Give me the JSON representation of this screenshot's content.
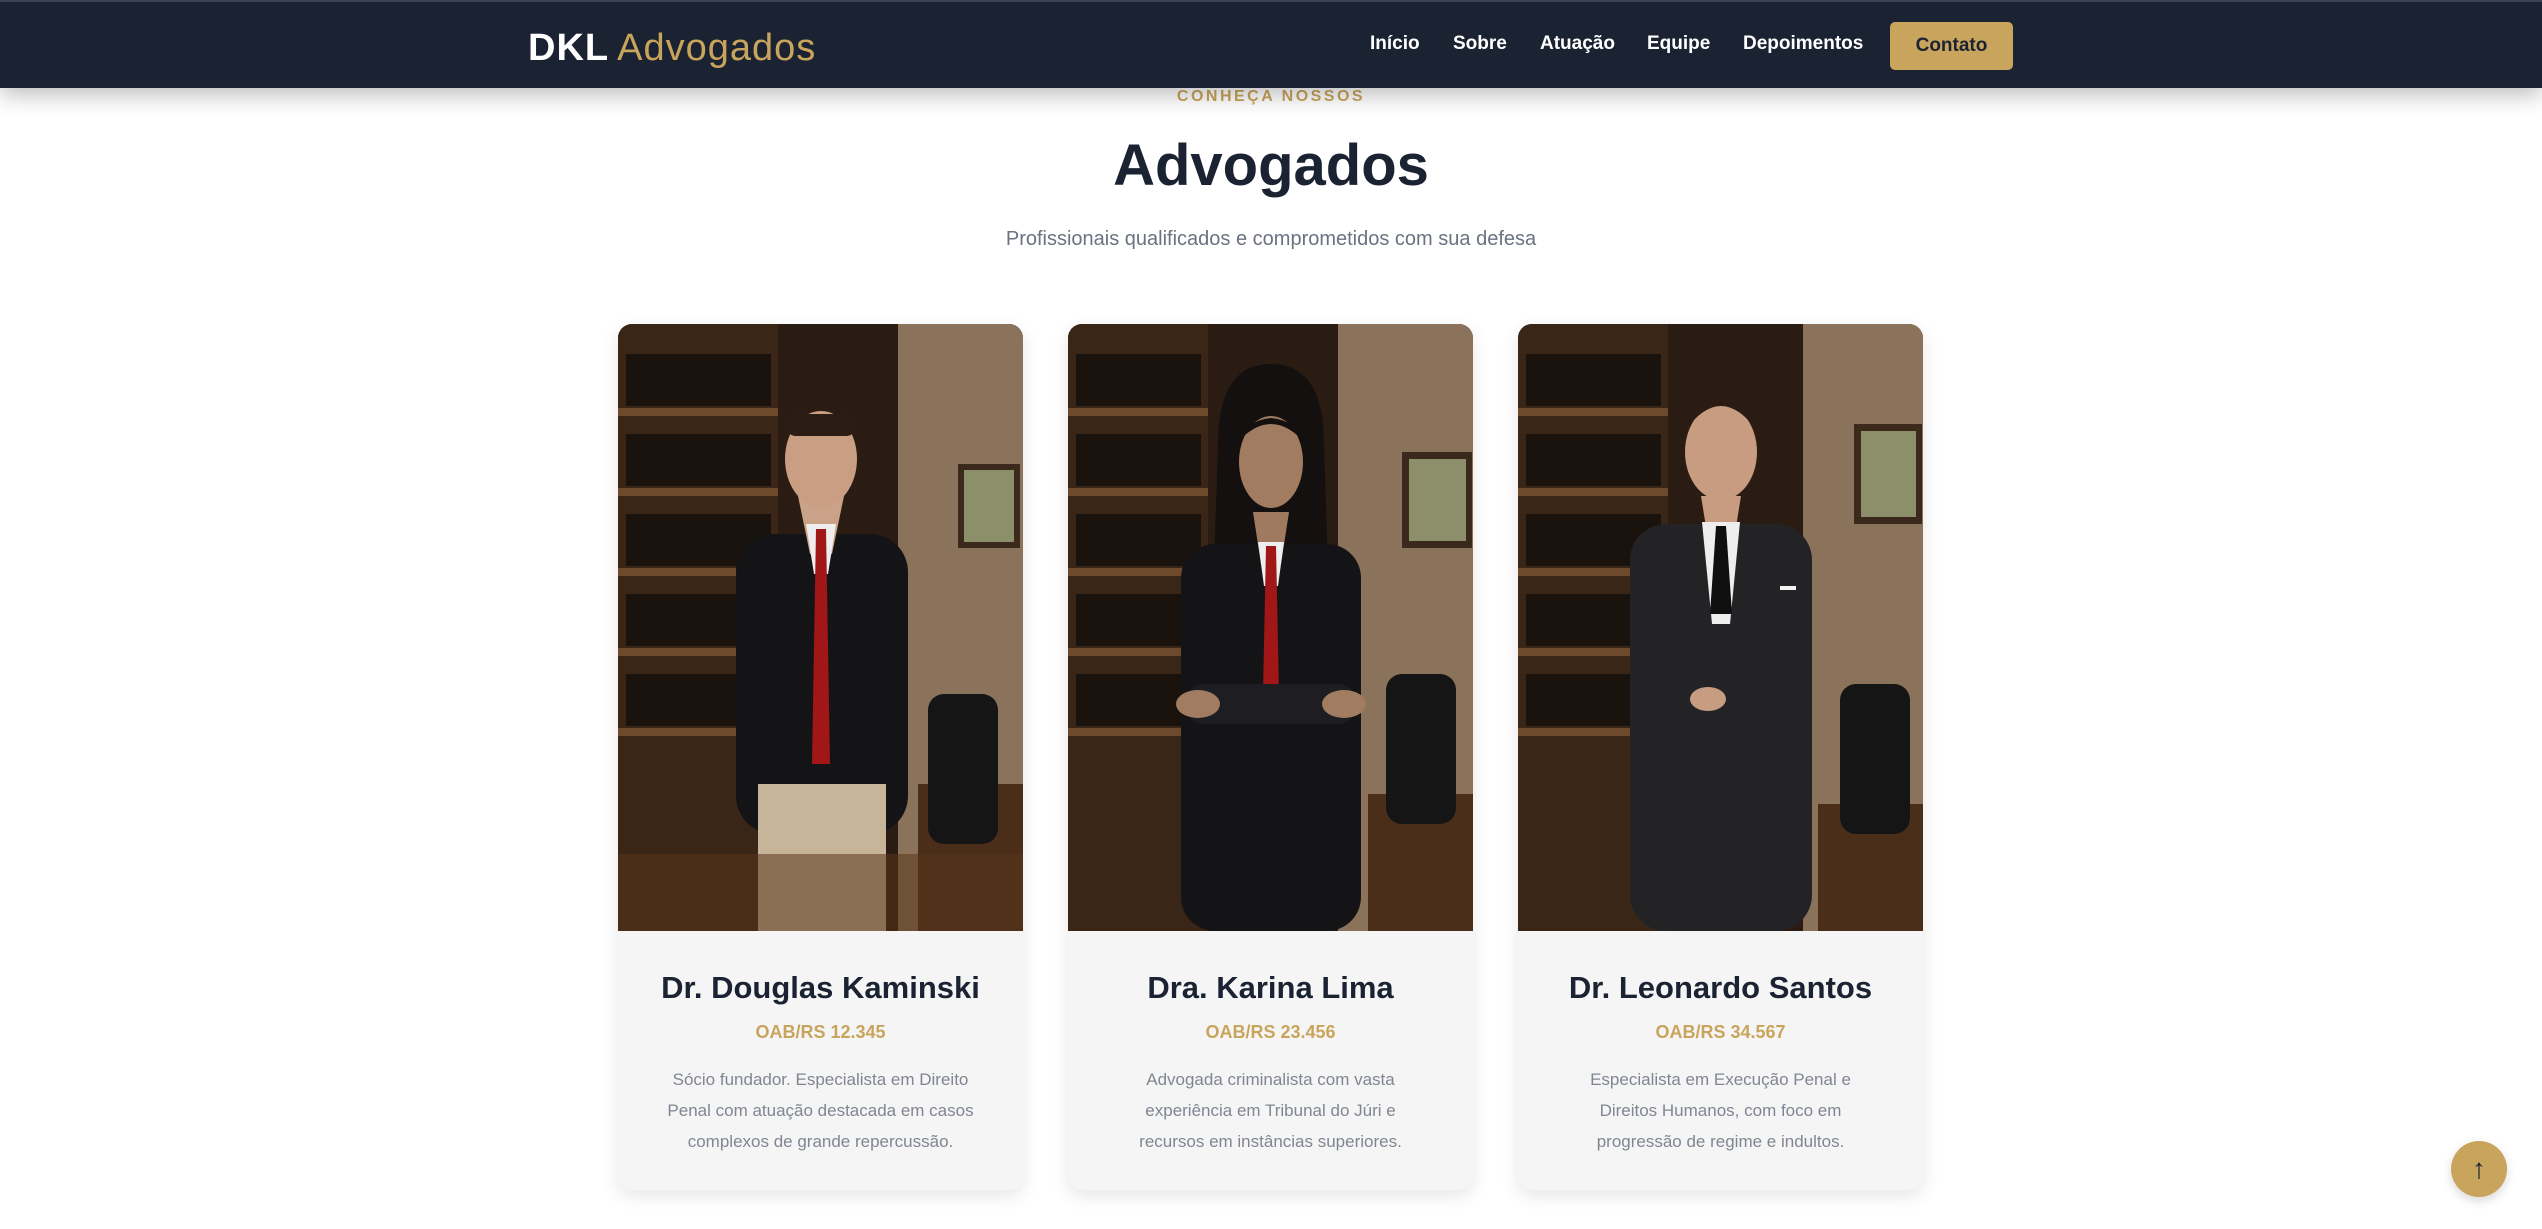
{
  "brand": {
    "bold": "DKL",
    "light": "Advogados"
  },
  "nav": {
    "items": [
      "Início",
      "Sobre",
      "Atuação",
      "Equipe",
      "Depoimentos"
    ],
    "cta": "Contato"
  },
  "section": {
    "eyebrow": "CONHEÇA NOSSOS",
    "title": "Advogados",
    "subtitle": "Profissionais qualificados e comprometidos com sua defesa"
  },
  "lawyers": [
    {
      "name": "Dr. Douglas Kaminski",
      "oab": "OAB/RS 12.345",
      "description": "Sócio fundador. Especialista em Direito Penal com atuação destacada em casos complexos de grande repercussão."
    },
    {
      "name": "Dra. Karina Lima",
      "oab": "OAB/RS 23.456",
      "description": "Advogada criminalista com vasta experiência em Tribunal do Júri e recursos em instâncias superiores."
    },
    {
      "name": "Dr. Leonardo Santos",
      "oab": "OAB/RS 34.567",
      "description": "Especialista em Execução Penal e Direitos Humanos, com foco em progressão de regime e indultos."
    }
  ],
  "back_to_top": {
    "icon": "arrow-up-icon",
    "glyph": "↑"
  },
  "colors": {
    "navy": "#1b2333",
    "gold": "#c9a45c",
    "card_bg": "#f5f5f6",
    "muted_text": "#808691"
  }
}
